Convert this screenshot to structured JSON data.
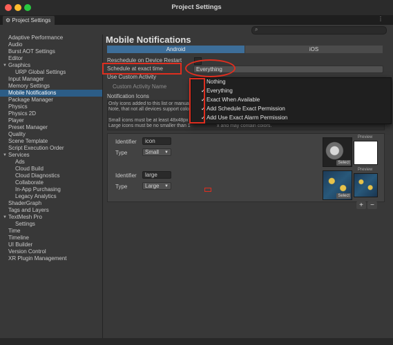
{
  "window": {
    "title": "Project Settings"
  },
  "tab": {
    "label": "Project Settings",
    "icon": "gear-icon"
  },
  "search": {
    "placeholder": ""
  },
  "sidebar": {
    "items": [
      {
        "label": "Adaptive Performance"
      },
      {
        "label": "Audio"
      },
      {
        "label": "Burst AOT Settings"
      },
      {
        "label": "Editor"
      },
      {
        "label": "Graphics"
      },
      {
        "label": "URP Global Settings"
      },
      {
        "label": "Input Manager"
      },
      {
        "label": "Memory Settings"
      },
      {
        "label": "Mobile Notifications"
      },
      {
        "label": "Package Manager"
      },
      {
        "label": "Physics"
      },
      {
        "label": "Physics 2D"
      },
      {
        "label": "Player"
      },
      {
        "label": "Preset Manager"
      },
      {
        "label": "Quality"
      },
      {
        "label": "Scene Template"
      },
      {
        "label": "Script Execution Order"
      },
      {
        "label": "Services"
      },
      {
        "label": "Ads"
      },
      {
        "label": "Cloud Build"
      },
      {
        "label": "Cloud Diagnostics"
      },
      {
        "label": "Collaborate"
      },
      {
        "label": "In-App Purchasing"
      },
      {
        "label": "Legacy Analytics"
      },
      {
        "label": "ShaderGraph"
      },
      {
        "label": "Tags and Layers"
      },
      {
        "label": "TextMesh Pro"
      },
      {
        "label": "Settings"
      },
      {
        "label": "Time"
      },
      {
        "label": "Timeline"
      },
      {
        "label": "UI Builder"
      },
      {
        "label": "Version Control"
      },
      {
        "label": "XR Plugin Management"
      }
    ],
    "selected": "Mobile Notifications"
  },
  "main": {
    "heading": "Mobile Notifications",
    "platform_tabs": [
      "Android",
      "iOS"
    ],
    "active_platform": "Android",
    "reschedule_label": "Reschedule on Device Restart",
    "schedule_label": "Schedule at exact time",
    "schedule_value": "Everything",
    "use_custom_activity_label": "Use Custom Activity",
    "custom_activity_name_label": "Custom Activity Name",
    "notification_icons_label": "Notification Icons",
    "info_line1": "Only icons added to this list or manually",
    "info_line2": "Note, that not all devices support colore",
    "info_line3": "Small icons must be at least 48x48px and",
    "info_line4": "Large icons must be no smaller than 1",
    "info_line4_tail": "x and may contain colors.",
    "icons": [
      {
        "identifier_label": "Identifier",
        "identifier": "icon",
        "type_label": "Type",
        "type": "Small",
        "preview_label": "Preview",
        "select_label": "Select"
      },
      {
        "identifier_label": "Identifier",
        "identifier": "large",
        "type_label": "Type",
        "type": "Large",
        "preview_label": "Preview",
        "select_label": "Select"
      }
    ],
    "add_label": "+",
    "remove_label": "−"
  },
  "popup": {
    "items": [
      {
        "label": "Nothing",
        "checked": false
      },
      {
        "label": "Everything",
        "checked": true
      },
      {
        "label": "Exact When Available",
        "checked": true
      },
      {
        "label": "Add Schedule Exact Permission",
        "checked": true
      },
      {
        "label": "Add Use Exact Alarm Permission",
        "checked": true
      }
    ],
    "check_glyph": "✓"
  },
  "colors": {
    "selection": "#2c5d87",
    "active_tab": "#3d6e99",
    "annotation": "#e02e1f"
  }
}
